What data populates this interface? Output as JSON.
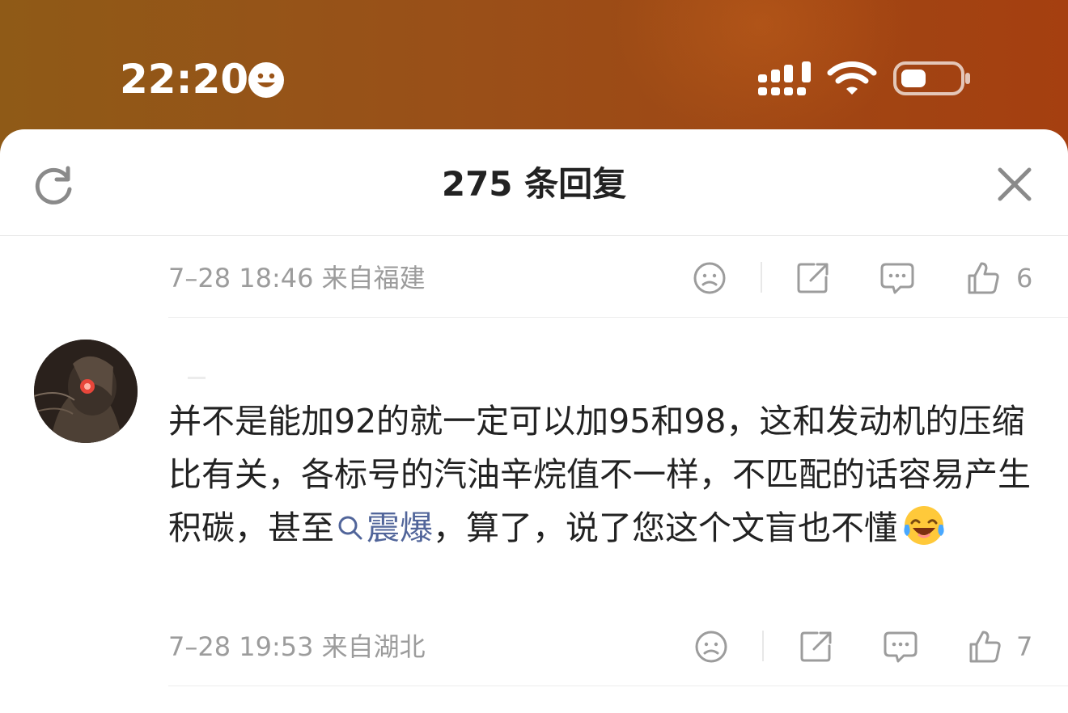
{
  "status_bar": {
    "time": "22:20",
    "icons": [
      "smiley-face-icon",
      "cellular-signal-icon",
      "wifi-icon",
      "battery-icon"
    ],
    "background_colors": [
      "#8f5a17",
      "#a53f10"
    ]
  },
  "header": {
    "title": "275 条回复",
    "left_icon": "refresh-icon",
    "right_icon": "close-icon"
  },
  "comments": [
    {
      "meta": "7–28 18:46  来自福建",
      "like_count": "6",
      "actions": [
        "dislike-icon",
        "share-icon",
        "reply-icon",
        "like-icon"
      ]
    },
    {
      "text_before_link": "并不是能加92的就一定可以加95和98，这和发动机的压缩比有关，各标号的汽油辛烷值不一样，不匹配的话容易产生积碳，甚至",
      "topic_link": "震爆",
      "text_after_link": "，算了，说了您这个文盲也不懂",
      "emoji": "laugh-cry-emoji",
      "meta": "7–28 19:53  来自湖北",
      "like_count": "7",
      "actions": [
        "dislike-icon",
        "share-icon",
        "reply-icon",
        "like-icon"
      ]
    }
  ],
  "colors": {
    "topic_link": "#51659a",
    "meta_gray": "#9c9c9c",
    "text": "#222222"
  }
}
